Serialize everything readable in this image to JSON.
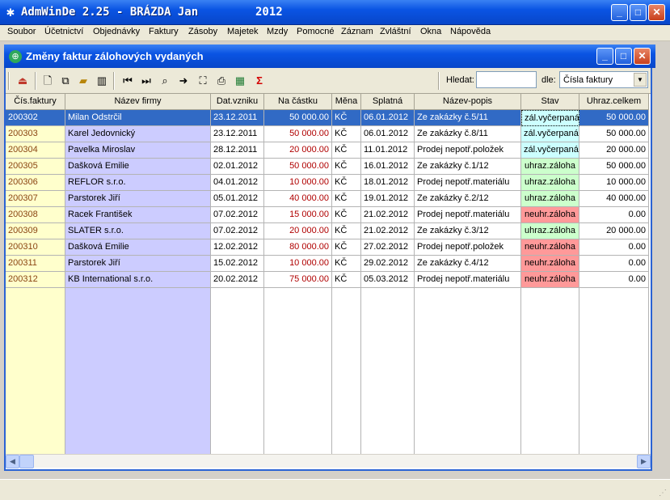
{
  "window": {
    "title": "AdmWinDe 2.25 - BRÁZDA Jan",
    "year": "2012",
    "app_icon": "paw-icon",
    "controls": {
      "minimize": "_",
      "maximize": "□",
      "close": "✕"
    }
  },
  "menu": [
    "Soubor",
    "Účetnictví",
    "Objednávky",
    "Faktury",
    "Zásoby",
    "Majetek",
    "Mzdy",
    "Pomocné",
    "Záznam",
    "Zvláštní",
    "Okna",
    "Nápověda"
  ],
  "child": {
    "title": "Změny faktur zálohových vydaných",
    "icon": "globe-icon"
  },
  "toolbar": {
    "search_label": "Hledat:",
    "search_value": "",
    "by_label": "dle:",
    "by_value": "Čísla faktury",
    "icons": [
      "exit-icon",
      "new-document-icon",
      "copy-icon",
      "open-folder-icon",
      "delete-icon",
      "first-record-icon",
      "last-record-icon",
      "search-icon",
      "goto-icon",
      "select-area-icon",
      "print-icon",
      "export-excel-icon",
      "sum-icon"
    ]
  },
  "columns": [
    "Čís.faktury",
    "Název firmy",
    "Dat.vzniku",
    "Na částku",
    "Měna",
    "Splatná",
    "Název-popis",
    "Stav",
    "Uhraz.celkem"
  ],
  "rows": [
    {
      "id": "200302",
      "firm": "Milan Odstrčil",
      "created": "23.12.2011",
      "amount": "50 000.00",
      "currency": "KČ",
      "due": "06.01.2012",
      "desc": "Ze zakázky č.5/11",
      "state": "zál.vyčerpaná",
      "paid": "50 000.00",
      "selected": true
    },
    {
      "id": "200303",
      "firm": "Karel Jedovnický",
      "created": "23.12.2011",
      "amount": "50 000.00",
      "currency": "KČ",
      "due": "06.01.2012",
      "desc": "Ze zakázky č.8/11",
      "state": "zál.vyčerpaná",
      "paid": "50 000.00"
    },
    {
      "id": "200304",
      "firm": "Pavelka Miroslav",
      "created": "28.12.2011",
      "amount": "20 000.00",
      "currency": "KČ",
      "due": "11.01.2012",
      "desc": "Prodej nepotř.položek",
      "state": "zál.vyčerpaná",
      "paid": "20 000.00"
    },
    {
      "id": "200305",
      "firm": "Dašková Emilie",
      "created": "02.01.2012",
      "amount": "50 000.00",
      "currency": "KČ",
      "due": "16.01.2012",
      "desc": "Ze zakázky č.1/12",
      "state": "uhraz.záloha",
      "paid": "50 000.00"
    },
    {
      "id": "200306",
      "firm": "REFLOR s.r.o.",
      "created": "04.01.2012",
      "amount": "10 000.00",
      "currency": "KČ",
      "due": "18.01.2012",
      "desc": "Prodej nepotř.materiálu",
      "state": "uhraz.záloha",
      "paid": "10 000.00"
    },
    {
      "id": "200307",
      "firm": "Parstorek Jiří",
      "created": "05.01.2012",
      "amount": "40 000.00",
      "currency": "KČ",
      "due": "19.01.2012",
      "desc": "Ze zakázky č.2/12",
      "state": "uhraz.záloha",
      "paid": "40 000.00"
    },
    {
      "id": "200308",
      "firm": "Racek František",
      "created": "07.02.2012",
      "amount": "15 000.00",
      "currency": "KČ",
      "due": "21.02.2012",
      "desc": "Prodej nepotř.materiálu",
      "state": "neuhr.záloha",
      "paid": "0.00"
    },
    {
      "id": "200309",
      "firm": "SLATER s.r.o.",
      "created": "07.02.2012",
      "amount": "20 000.00",
      "currency": "KČ",
      "due": "21.02.2012",
      "desc": "Ze zakázky č.3/12",
      "state": "uhraz.záloha",
      "paid": "20 000.00"
    },
    {
      "id": "200310",
      "firm": "Dašková Emilie",
      "created": "12.02.2012",
      "amount": "80 000.00",
      "currency": "KČ",
      "due": "27.02.2012",
      "desc": "Prodej nepotř.položek",
      "state": "neuhr.záloha",
      "paid": "0.00"
    },
    {
      "id": "200311",
      "firm": "Parstorek Jiří",
      "created": "15.02.2012",
      "amount": "10 000.00",
      "currency": "KČ",
      "due": "29.02.2012",
      "desc": "Ze zakázky č.4/12",
      "state": "neuhr.záloha",
      "paid": "0.00"
    },
    {
      "id": "200312",
      "firm": "KB International s.r.o.",
      "created": "20.02.2012",
      "amount": "75 000.00",
      "currency": "KČ",
      "due": "05.03.2012",
      "desc": "Prodej nepotř.materiálu",
      "state": "neuhr.záloha",
      "paid": "0.00"
    }
  ],
  "colors": {
    "id_col_bg": "#ffffcc",
    "firm_col_bg": "#ccccff",
    "id_text": "#8b4513",
    "amount_text": "#b00000",
    "selected_bg": "#316ac5",
    "state_used": "#ccffff",
    "state_paid": "#ccffcc",
    "state_unpaid": "#ff9999"
  }
}
